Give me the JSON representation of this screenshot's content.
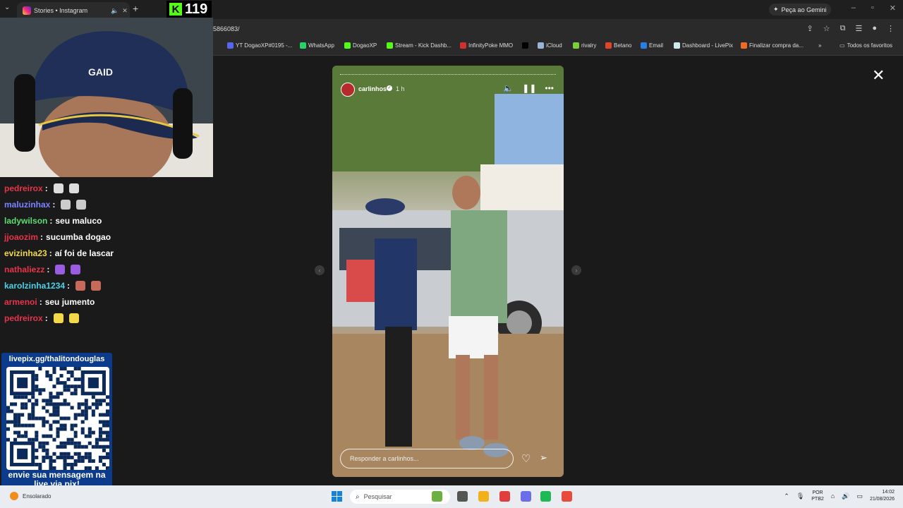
{
  "browser": {
    "tab": {
      "title": "Stories • Instagram"
    },
    "new_tab": "+",
    "url": "5866083/",
    "gemini": "Peça ao Gemini",
    "bookmarks": [
      {
        "label": "YT DogaoXP#0195 -...",
        "color": "#5865f2"
      },
      {
        "label": "WhatsApp",
        "color": "#25d366"
      },
      {
        "label": "DogaoXP",
        "color": "#53fc18"
      },
      {
        "label": "Stream - Kick Dashb...",
        "color": "#53fc18"
      },
      {
        "label": "InfinityPoke MMO",
        "color": "#d03030"
      },
      {
        "label": "",
        "color": "#000000"
      },
      {
        "label": "iCloud",
        "color": "#9ab4d8"
      },
      {
        "label": "rivalry",
        "color": "#7bd03a"
      },
      {
        "label": "Betano",
        "color": "#e0442a"
      },
      {
        "label": "Email",
        "color": "#2a7de1"
      },
      {
        "label": "Dashboard - LivePix",
        "color": "#cfe9ef"
      },
      {
        "label": "Finalizar compra da...",
        "color": "#ee6a25"
      }
    ],
    "bookmarks_more": "»",
    "all_favorites": "Todos os favoritos"
  },
  "stream": {
    "viewer_count": "119",
    "kick_logo": "K",
    "chat": [
      {
        "user": "pedreirox",
        "color": "#e8344a",
        "text": "",
        "emotes": [
          "#dddddd",
          "#dddddd"
        ]
      },
      {
        "user": "maluzinhax",
        "color": "#7a84ff",
        "text": "",
        "emotes": [
          "#cccccc",
          "#cccccc"
        ]
      },
      {
        "user": "ladywilson",
        "color": "#5dde72",
        "text": "seu maluco",
        "emotes": []
      },
      {
        "user": "jjoaozim",
        "color": "#e8344a",
        "text": "sucumba dogao",
        "emotes": []
      },
      {
        "user": "evizinha23",
        "color": "#f2d94a",
        "text": "aí foi de lascar",
        "emotes": []
      },
      {
        "user": "nathaliezz",
        "color": "#e8344a",
        "text": "",
        "emotes": [
          "#9a5ce0",
          "#9a5ce0"
        ]
      },
      {
        "user": "karolzinha1234",
        "color": "#4ad3e8",
        "text": "",
        "emotes": [
          "#c86a5a",
          "#c86a5a"
        ]
      },
      {
        "user": "armenoi",
        "color": "#e8344a",
        "text": "seu jumento",
        "emotes": []
      },
      {
        "user": "pedreirox",
        "color": "#e8344a",
        "text": "",
        "emotes": [
          "#f2d94a",
          "#f2d94a"
        ]
      }
    ],
    "livepix": {
      "url": "livepix.gg/thalitondouglas",
      "message": "envie sua mensagem na live via pix!"
    }
  },
  "story": {
    "username": "carlinhos",
    "time": "1 h",
    "reply_placeholder": "Responder a carlinhos...",
    "icons": {
      "mute": "🔈",
      "pause": "❚❚",
      "more": "•••",
      "heart": "♡",
      "send": "➢",
      "close": "✕",
      "prev": "‹",
      "next": "›"
    }
  },
  "taskbar": {
    "weather": "Ensolarado",
    "search": "Pesquisar",
    "lang_top": "POR",
    "lang_bottom": "PTB2",
    "time": "14:02",
    "date": "21/08/2026",
    "apps": [
      "#6bb041",
      "#555555",
      "#f2b01b",
      "#e23d3d",
      "#6b6ee6",
      "#1db954",
      "#e84a3c"
    ]
  }
}
